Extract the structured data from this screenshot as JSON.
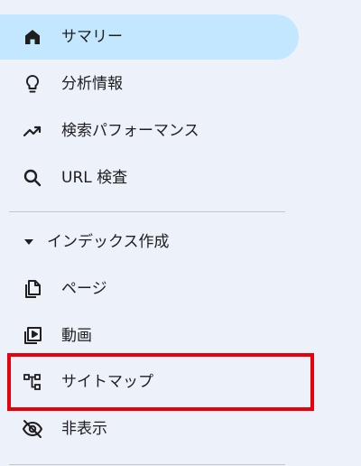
{
  "nav": {
    "items": [
      {
        "label": "サマリー",
        "icon": "home-icon",
        "active": true
      },
      {
        "label": "分析情報",
        "icon": "lightbulb-icon"
      },
      {
        "label": "検索パフォーマンス",
        "icon": "trending-up-icon"
      },
      {
        "label": "URL 検査",
        "icon": "search-icon"
      }
    ],
    "indexing_section": {
      "label": "インデックス作成",
      "items": [
        {
          "label": "ページ",
          "icon": "pages-icon"
        },
        {
          "label": "動画",
          "icon": "video-icon"
        },
        {
          "label": "サイトマップ",
          "icon": "sitemap-icon",
          "highlighted": true
        },
        {
          "label": "非表示",
          "icon": "visibility-off-icon"
        }
      ]
    }
  },
  "colors": {
    "background": "#edf1fa",
    "active_pill": "#c2e7ff",
    "highlight_box": "#e8000b",
    "divider": "#c4c7c5",
    "icon": "#1f1f1f"
  }
}
